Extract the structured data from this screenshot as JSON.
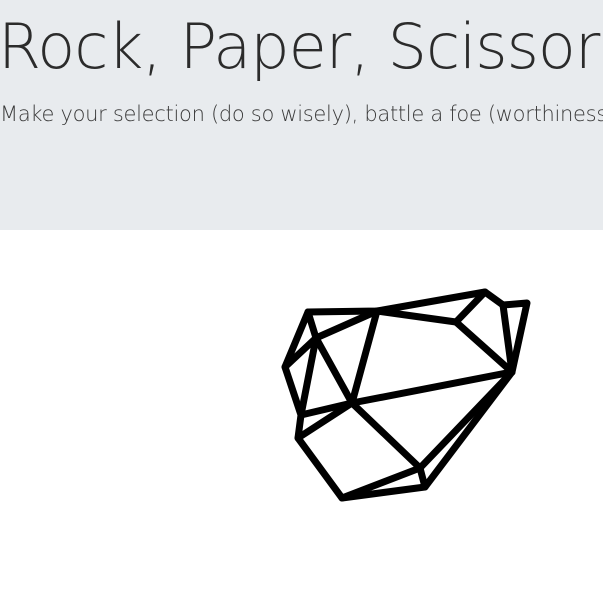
{
  "hero": {
    "title": "Rock, Paper, Scissors!",
    "subtitle": "Make your selection (do so wisely), battle a foe (worthiness not guaranteed)"
  },
  "choices": [
    {
      "name": "rock",
      "icon": "rock-icon"
    }
  ],
  "colors": {
    "hero_background": "#e8ebee",
    "page_background": "#ffffff",
    "text": "#2b2b2b",
    "icon_stroke": "#000000"
  }
}
